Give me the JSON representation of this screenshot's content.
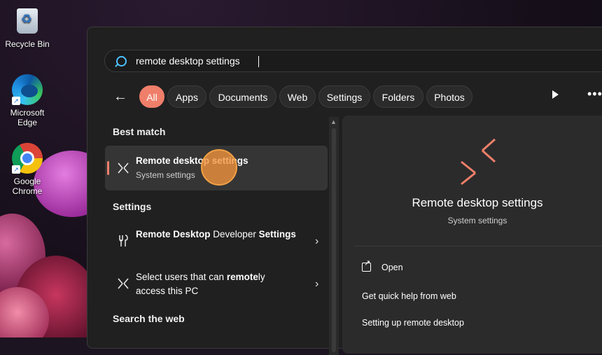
{
  "desktop": {
    "icons": [
      {
        "label": "Recycle Bin",
        "icon": "recycle-bin-icon"
      },
      {
        "label": "Microsoft Edge",
        "icon": "edge-icon"
      },
      {
        "label": "Google Chrome",
        "icon": "chrome-icon"
      }
    ]
  },
  "search": {
    "query": "remote desktop settings",
    "placeholder": ""
  },
  "filters": [
    "All",
    "Apps",
    "Documents",
    "Web",
    "Settings",
    "Folders",
    "Photos"
  ],
  "active_filter": "All",
  "results": {
    "best_match_title": "Best match",
    "best_match": {
      "title": "Remote desktop settings",
      "subtitle": "System settings"
    },
    "settings_title": "Settings",
    "settings_items": [
      {
        "part1": "Remote Desktop",
        "part2": " Developer ",
        "part3": "Settings"
      },
      {
        "part1": "Select users that can ",
        "part2": "remote",
        "part3": "ly access this PC"
      }
    ],
    "web_title": "Search the web"
  },
  "preview": {
    "title": "Remote desktop settings",
    "subtitle": "System settings",
    "actions": [
      "Open",
      "Get quick help from web",
      "Setting up remote desktop"
    ]
  },
  "colors": {
    "accent": "#ef7f6a",
    "search_icon": "#4cc2ff",
    "panel_bg": "#202020"
  }
}
